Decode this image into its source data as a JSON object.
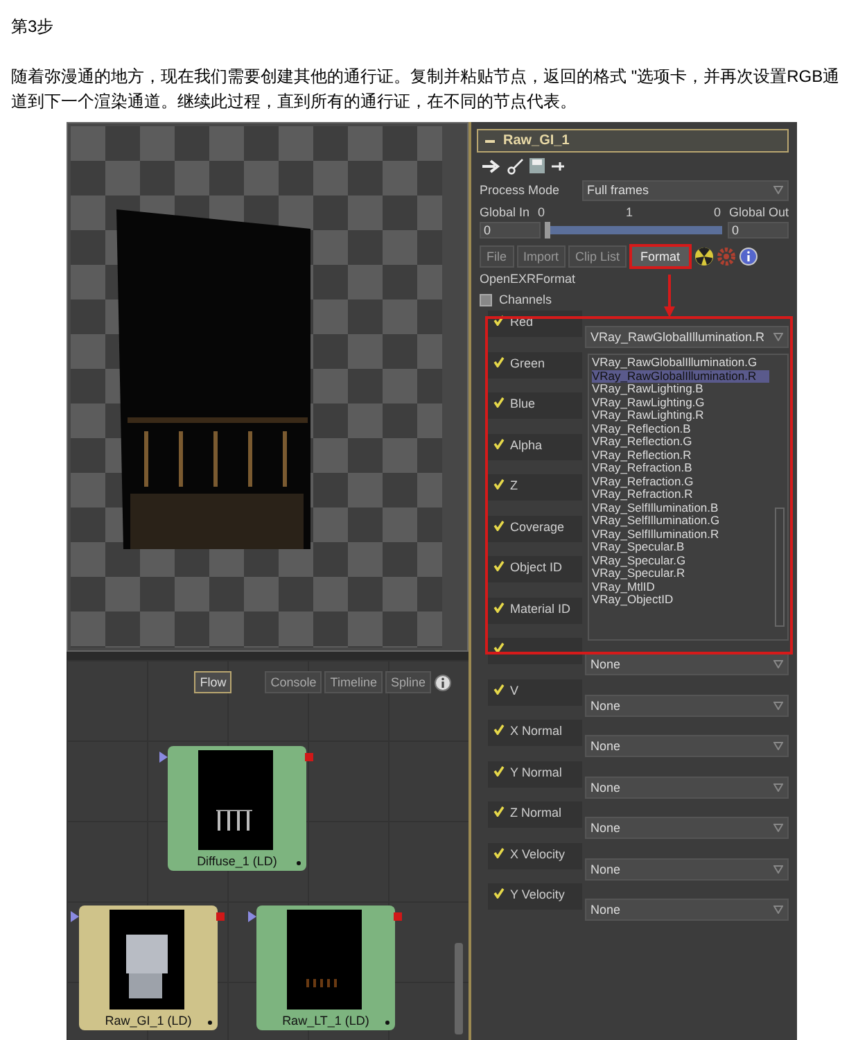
{
  "step_title": "第3步",
  "paragraph": "随着弥漫通的地方，现在我们需要创建其他的通行证。复制并粘贴节点，返回的格式 \"选项卡，并再次设置RGB通道到下一个渲染通道。继续此过程，直到所有的通行证，在不同的节点代表。",
  "flow": {
    "tabs": [
      {
        "label": "Flow",
        "selected": true
      },
      {
        "label": "Console",
        "selected": false
      },
      {
        "label": "Timeline",
        "selected": false
      },
      {
        "label": "Spline",
        "selected": false
      }
    ],
    "nodes": [
      {
        "label": "Diffuse_1 (LD)",
        "color": "#7db47f"
      },
      {
        "label": "Raw_GI_1 (LD)",
        "color": "#cfc38a"
      },
      {
        "label": "Raw_LT_1 (LD)",
        "color": "#7db47f"
      }
    ]
  },
  "inspector": {
    "title": "Raw_GI_1",
    "process_mode": {
      "label": "Process Mode",
      "value": "Full frames"
    },
    "global_in": {
      "label": "Global In",
      "value": "0"
    },
    "global_out": {
      "label": "Global Out",
      "value": "0"
    },
    "range_ticks": [
      "0",
      "1",
      "0"
    ],
    "range_slider": {
      "level": 0
    },
    "tabs": [
      {
        "label": "File",
        "selected": false
      },
      {
        "label": "Import",
        "selected": false
      },
      {
        "label": "Clip List",
        "selected": false
      },
      {
        "label": "Format",
        "selected": true
      }
    ],
    "format_name": "OpenEXRFormat",
    "section": {
      "label": "Channels",
      "expanded": true
    },
    "channels": [
      {
        "name": "Red",
        "checked": true,
        "value": "VRay_RawGlobalIllumination.R"
      },
      {
        "name": "Green",
        "checked": true
      },
      {
        "name": "Blue",
        "checked": true
      },
      {
        "name": "Alpha",
        "checked": true
      },
      {
        "name": "Z",
        "checked": true
      },
      {
        "name": "Coverage",
        "checked": true
      },
      {
        "name": "Object ID",
        "checked": true
      },
      {
        "name": "Material ID",
        "checked": true
      },
      {
        "checked": true,
        "value": "None"
      },
      {
        "name": "V",
        "checked": true,
        "value": "None"
      },
      {
        "name": "X Normal",
        "checked": true,
        "value": "None"
      },
      {
        "name": "Y Normal",
        "checked": true,
        "value": "None"
      },
      {
        "name": "Z Normal",
        "checked": true,
        "value": "None"
      },
      {
        "name": "X Velocity",
        "checked": true,
        "value": "None"
      },
      {
        "name": "Y Velocity",
        "checked": true,
        "value": "None"
      }
    ],
    "dropdown_list": [
      {
        "label": "VRay_RawGlobalIllumination.G",
        "selected": false
      },
      {
        "label": "VRay_RawGlobalIllumination.R",
        "selected": true
      },
      {
        "label": "VRay_RawLighting.B",
        "selected": false
      },
      {
        "label": "VRay_RawLighting.G",
        "selected": false
      },
      {
        "label": "VRay_RawLighting.R",
        "selected": false
      },
      {
        "label": "VRay_Reflection.B",
        "selected": false
      },
      {
        "label": "VRay_Reflection.G",
        "selected": false
      },
      {
        "label": "VRay_Reflection.R",
        "selected": false
      },
      {
        "label": "VRay_Refraction.B",
        "selected": false
      },
      {
        "label": "VRay_Refraction.G",
        "selected": false
      },
      {
        "label": "VRay_Refraction.R",
        "selected": false
      },
      {
        "label": "VRay_SelfIllumination.B",
        "selected": false
      },
      {
        "label": "VRay_SelfIllumination.G",
        "selected": false
      },
      {
        "label": "VRay_SelfIllumination.R",
        "selected": false
      },
      {
        "label": "VRay_Specular.B",
        "selected": false
      },
      {
        "label": "VRay_Specular.G",
        "selected": false
      },
      {
        "label": "VRay_Specular.R",
        "selected": false
      },
      {
        "label": "VRay_MtlID",
        "selected": false
      },
      {
        "label": "VRay_ObjectID",
        "selected": false
      }
    ]
  }
}
